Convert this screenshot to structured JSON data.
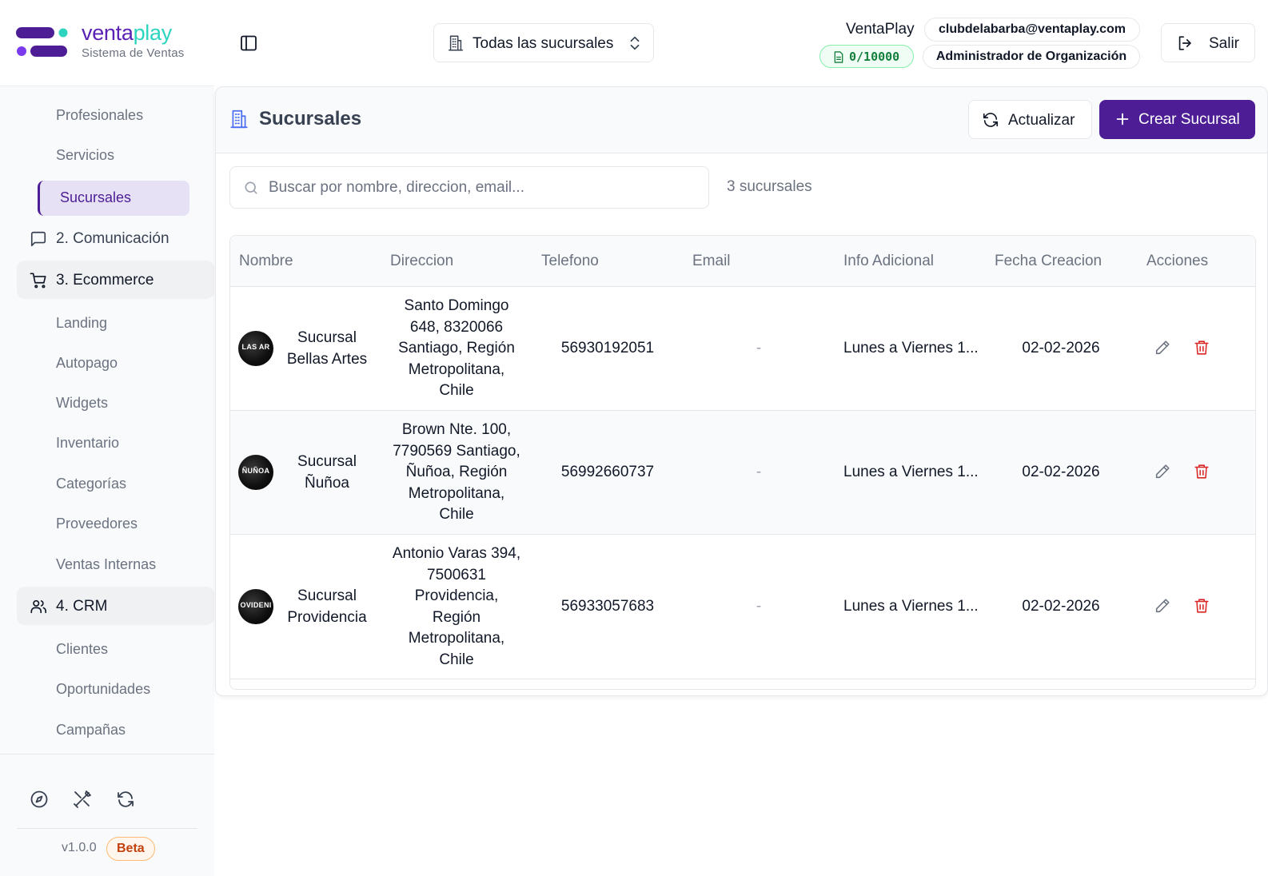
{
  "brand": {
    "name_part1": "venta",
    "name_part2": "play",
    "subtitle": "Sistema de Ventas",
    "colors": {
      "primary": "#4c1d95",
      "accent": "#2dd4bf"
    }
  },
  "sidebar": {
    "subitems_top": [
      "Profesionales",
      "Servicios"
    ],
    "active_item": "Sucursales",
    "groups": [
      {
        "label": "2. Comunicación",
        "icon": "message-icon"
      },
      {
        "label": "3. Ecommerce",
        "icon": "cart-icon",
        "items": [
          "Landing",
          "Autopago",
          "Widgets",
          "Inventario",
          "Categorías",
          "Proveedores",
          "Ventas Internas"
        ]
      },
      {
        "label": "4. CRM",
        "icon": "users-icon",
        "items": [
          "Clientes",
          "Oportunidades",
          "Campañas"
        ]
      }
    ],
    "bottom_icons": [
      "compass-icon",
      "tools-icon",
      "refresh-icon"
    ],
    "version": "v1.0.0",
    "beta": "Beta"
  },
  "header": {
    "branch_selector": "Todas las sucursales",
    "org_name": "VentaPlay",
    "email": "clubdelabarba@ventaplay.com",
    "quota": "0/10000",
    "role": "Administrador de Organización",
    "logout": "Salir"
  },
  "page": {
    "title": "Sucursales",
    "refresh": "Actualizar",
    "create": "Crear Sucursal",
    "search_placeholder": "Buscar por nombre, direccion, email...",
    "count": "3 sucursales"
  },
  "table": {
    "columns": [
      "Nombre",
      "Direccion",
      "Telefono",
      "Email",
      "Info Adicional",
      "Fecha Creacion",
      "Acciones"
    ],
    "rows": [
      {
        "avatar_text": "LAS AR",
        "name": [
          "Sucursal",
          "Bellas Artes"
        ],
        "address": [
          "Santo Domingo",
          "648, 8320066",
          "Santiago, Región",
          "Metropolitana,",
          "Chile"
        ],
        "phone": "56930192051",
        "email": "-",
        "info": "Lunes a Viernes 1...",
        "date": "02-02-2026"
      },
      {
        "avatar_text": "ÑUÑOA",
        "name": [
          "Sucursal",
          "Ñuñoa"
        ],
        "address": [
          "Brown Nte. 100,",
          "7790569 Santiago,",
          "Ñuñoa, Región",
          "Metropolitana,",
          "Chile"
        ],
        "phone": "56992660737",
        "email": "-",
        "info": "Lunes a Viernes 1...",
        "date": "02-02-2026"
      },
      {
        "avatar_text": "OVIDENI",
        "name": [
          "Sucursal",
          "Providencia"
        ],
        "address": [
          "Antonio Varas 394,",
          "7500631",
          "Providencia,",
          "Región",
          "Metropolitana,",
          "Chile"
        ],
        "phone": "56933057683",
        "email": "-",
        "info": "Lunes a Viernes 1...",
        "date": "02-02-2026"
      }
    ]
  }
}
